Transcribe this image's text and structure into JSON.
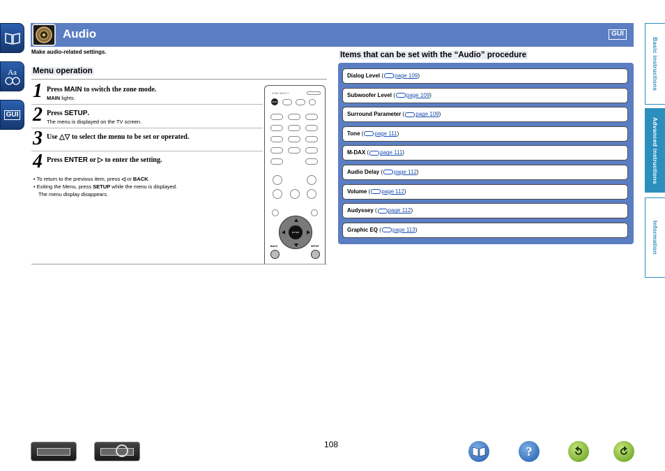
{
  "header": {
    "title": "Audio",
    "gui_badge": "GUI",
    "subtitle": "Make audio-related settings."
  },
  "left_nav": {
    "font_badge": "Aa",
    "gui_badge": "GUI"
  },
  "menu_operation": {
    "heading": "Menu operation",
    "steps": [
      {
        "num": "1",
        "pre": "Press ",
        "key": "MAIN",
        "post": " to switch the zone mode.",
        "sub_key": "MAIN",
        "sub_text": " lights."
      },
      {
        "num": "2",
        "pre": "Press ",
        "key": "SETUP",
        "post": ".",
        "sub_text": "The menu is displayed on the TV screen."
      },
      {
        "num": "3",
        "pre": "Use ",
        "key": "△▽",
        "post": " to select the menu to be set or operated."
      },
      {
        "num": "4",
        "pre": "Press ",
        "key": "ENTER",
        "mid": " or ",
        "key2": "▷",
        "post": " to enter the setting."
      }
    ],
    "notes": {
      "line1_pre": "• To return to the previous item, press ",
      "line1_key1": "◁",
      "line1_mid": " or ",
      "line1_key2": "BACK",
      "line1_post": ".",
      "line2_pre": "• Exiting the Menu, press ",
      "line2_key": "SETUP",
      "line2_post": " while the menu is displayed.",
      "line3": "The menu display disappears."
    }
  },
  "remote": {
    "zone_select": "ZONE SELECT",
    "main": "MAIN",
    "enter": "ENTER",
    "back": "BACK",
    "setup": "SETUP"
  },
  "items": {
    "heading": "Items that can be set with the “Audio” procedure",
    "list": [
      {
        "label": "Dialog Level",
        "page": "page 109"
      },
      {
        "label": "Subwoofer Level",
        "page": "page 109"
      },
      {
        "label": "Surround Parameter",
        "page": "page 109"
      },
      {
        "label": "Tone",
        "page": "page 111"
      },
      {
        "label": "M-DAX",
        "page": "page 111"
      },
      {
        "label": "Audio Delay",
        "page": "page 112"
      },
      {
        "label": "Volume",
        "page": "page 112"
      },
      {
        "label": "Audyssey",
        "page": "page 112"
      },
      {
        "label": "Graphic EQ",
        "page": "page 113"
      }
    ],
    "open_paren": " (",
    "close_paren": ")"
  },
  "right_tabs": [
    {
      "label": "Basic instructions",
      "active": false
    },
    {
      "label": "Advanced instructions",
      "active": true
    },
    {
      "label": "Information",
      "active": false
    }
  ],
  "footer": {
    "page_number": "108",
    "help_glyph": "?"
  },
  "colors": {
    "header_blue": "#5b7ec3",
    "tab_blue": "#2b8fbd",
    "link_blue": "#1a4fb3"
  }
}
